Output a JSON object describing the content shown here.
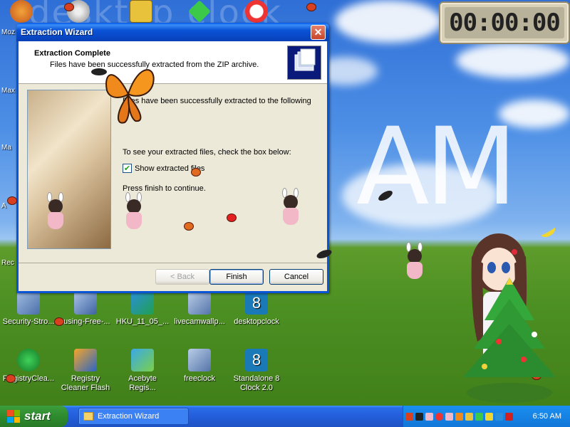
{
  "clock": {
    "time": "00:00:00"
  },
  "watermark": {
    "text": "AM"
  },
  "left_cut_labels": [
    "Moz",
    "Max",
    "Ma",
    "A",
    "Rec"
  ],
  "desktop_icons": [
    {
      "label": "Security-Stro..."
    },
    {
      "label": "rusing-Free-..."
    },
    {
      "label": "HKU_11_05_..."
    },
    {
      "label": "livecamwallp..."
    },
    {
      "label": "desktopclock"
    },
    {
      "label": "RegistryClea..."
    },
    {
      "label": "Registry Cleaner Flash"
    },
    {
      "label": "Acebyte Regis..."
    },
    {
      "label": "freeclock"
    },
    {
      "label": "Standalone 8 Clock 2.0"
    }
  ],
  "window": {
    "title": "Extraction Wizard",
    "close_label": "✕",
    "header_title": "Extraction Complete",
    "header_subtitle": "Files have been successfully extracted from the ZIP archive.",
    "text1": "Files have been successfully extracted to the following",
    "text2": "To see your extracted files, check the box below:",
    "checkbox_label": "Show extracted files",
    "checkbox_checked": true,
    "text3": "Press finish to continue.",
    "back_label": "< Back",
    "finish_label": "Finish",
    "cancel_label": "Cancel"
  },
  "taskbar": {
    "start_label": "start",
    "task_label": "Extraction Wizard",
    "time": "6:50 AM"
  },
  "colors": {
    "title_blue": "#0a53d8",
    "start_green": "#2e8b2e",
    "taskbar_blue": "#245edb"
  }
}
